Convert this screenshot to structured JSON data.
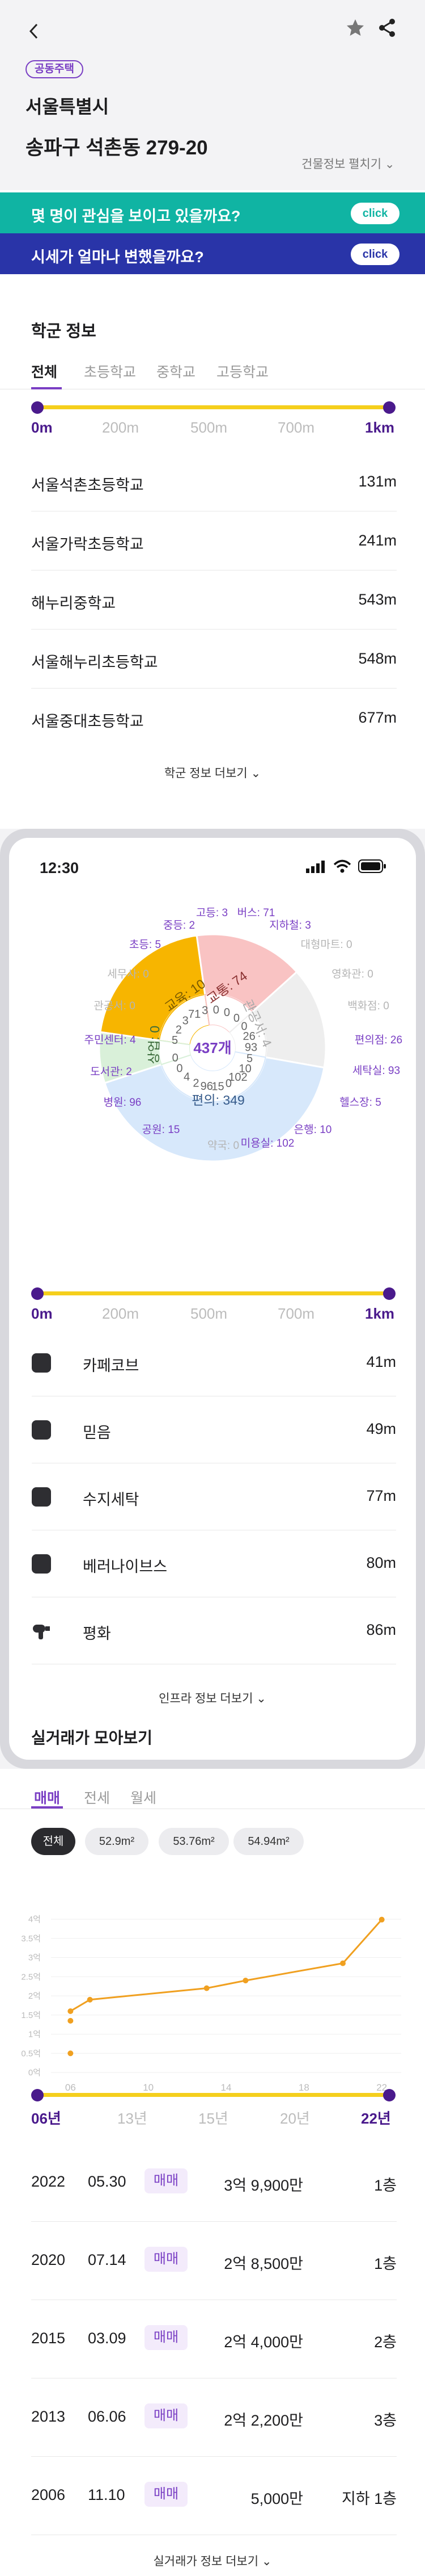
{
  "header": {
    "badge": "공동주택",
    "city": "서울특별시",
    "address": "송파구 석촌동 279-20",
    "building_info": "건물정보 펼치기"
  },
  "banners": [
    {
      "text": "몇 명이 관심을 보이고 있을까요?",
      "button": "click",
      "color": "#10b4a3"
    },
    {
      "text": "시세가 얼마나 변했을까요?",
      "button": "click",
      "color": "#2934a8"
    }
  ],
  "school": {
    "title": "학군 정보",
    "tabs": [
      "전체",
      "초등학교",
      "중학교",
      "고등학교"
    ],
    "distance_labels": [
      "0m",
      "200m",
      "500m",
      "700m",
      "1km"
    ],
    "items": [
      {
        "name": "서울석촌초등학교",
        "distance": "131m"
      },
      {
        "name": "서울가락초등학교",
        "distance": "241m"
      },
      {
        "name": "해누리중학교",
        "distance": "543m"
      },
      {
        "name": "서울해누리초등학교",
        "distance": "548m"
      },
      {
        "name": "서울중대초등학교",
        "distance": "677m"
      }
    ],
    "more": "학군 정보 더보기"
  },
  "phone": {
    "time": "12:30"
  },
  "infra": {
    "total": "437개",
    "outer_labels": [
      "고등: 3",
      "버스: 71",
      "중등: 2",
      "지하철: 3",
      "초등: 5",
      "대형마트: 0",
      "세무사: 0",
      "영화관: 0",
      "관공서: 0",
      "백화점: 0",
      "주민센터: 4",
      "편의점: 26",
      "도서관: 2",
      "세탁실: 93",
      "병원: 96",
      "헬스장: 5",
      "공원: 15",
      "은행: 10",
      "약국: 0",
      "미용실: 102"
    ],
    "segment_labels": [
      "교육: 10",
      "교통: 74",
      "관공서: 4",
      "편의: 349",
      "상업: 0"
    ],
    "inner_numbers": [
      "5",
      "2",
      "3",
      "71",
      "3",
      "0",
      "0",
      "0",
      "0",
      "26",
      "93",
      "5",
      "10",
      "102",
      "0",
      "15",
      "96",
      "2",
      "4",
      "0",
      "0"
    ],
    "distance_labels": [
      "0m",
      "200m",
      "500m",
      "700m",
      "1km"
    ],
    "items": [
      {
        "name": "카페코브",
        "distance": "41m"
      },
      {
        "name": "믿음",
        "distance": "49m"
      },
      {
        "name": "수지세탁",
        "distance": "77m"
      },
      {
        "name": "베러나이브스",
        "distance": "80m"
      },
      {
        "name": "평화",
        "distance": "86m"
      }
    ],
    "more": "인프라 정보 더보기"
  },
  "trade": {
    "title": "실거래가 모아보기",
    "tabs": [
      "매매",
      "전세",
      "월세"
    ],
    "chips": [
      "전체",
      "52.9m²",
      "53.76m²",
      "54.94m²"
    ],
    "year_labels": [
      "06년",
      "13년",
      "15년",
      "20년",
      "22년"
    ],
    "rows": [
      {
        "year": "2022",
        "date": "05.30",
        "type": "매매",
        "price": "3억 9,900만",
        "floor": "1층"
      },
      {
        "year": "2020",
        "date": "07.14",
        "type": "매매",
        "price": "2억 8,500만",
        "floor": "1층"
      },
      {
        "year": "2015",
        "date": "03.09",
        "type": "매매",
        "price": "2억 4,000만",
        "floor": "2층"
      },
      {
        "year": "2013",
        "date": "06.06",
        "type": "매매",
        "price": "2억 2,200만",
        "floor": "3층"
      },
      {
        "year": "2006",
        "date": "11.10",
        "type": "매매",
        "price": "5,000만",
        "floor": "지하 1층"
      }
    ],
    "more": "실거래가 정보 더보기"
  },
  "chart_data": {
    "type": "line",
    "y_ticks": [
      "4억",
      "3.5억",
      "3억",
      "2.5억",
      "2억",
      "1.5억",
      "1억",
      "0.5억",
      "0억"
    ],
    "x_ticks": [
      "06",
      "10",
      "14",
      "18",
      "22"
    ],
    "x": [
      2006,
      2007,
      2013,
      2015,
      2020,
      2022
    ],
    "y": [
      1.6,
      1.9,
      2.2,
      2.4,
      2.85,
      3.99
    ],
    "outliers": [
      {
        "x": 2006,
        "y": 1.35
      },
      {
        "x": 2006,
        "y": 0.5
      }
    ],
    "ylim": [
      0,
      4
    ],
    "xlim": [
      2005,
      2023
    ],
    "color": "#f0a020"
  },
  "colors": {
    "accent": "#7a3fc4",
    "navy": "#4a1a8c",
    "yellow": "#f5cf1c"
  }
}
